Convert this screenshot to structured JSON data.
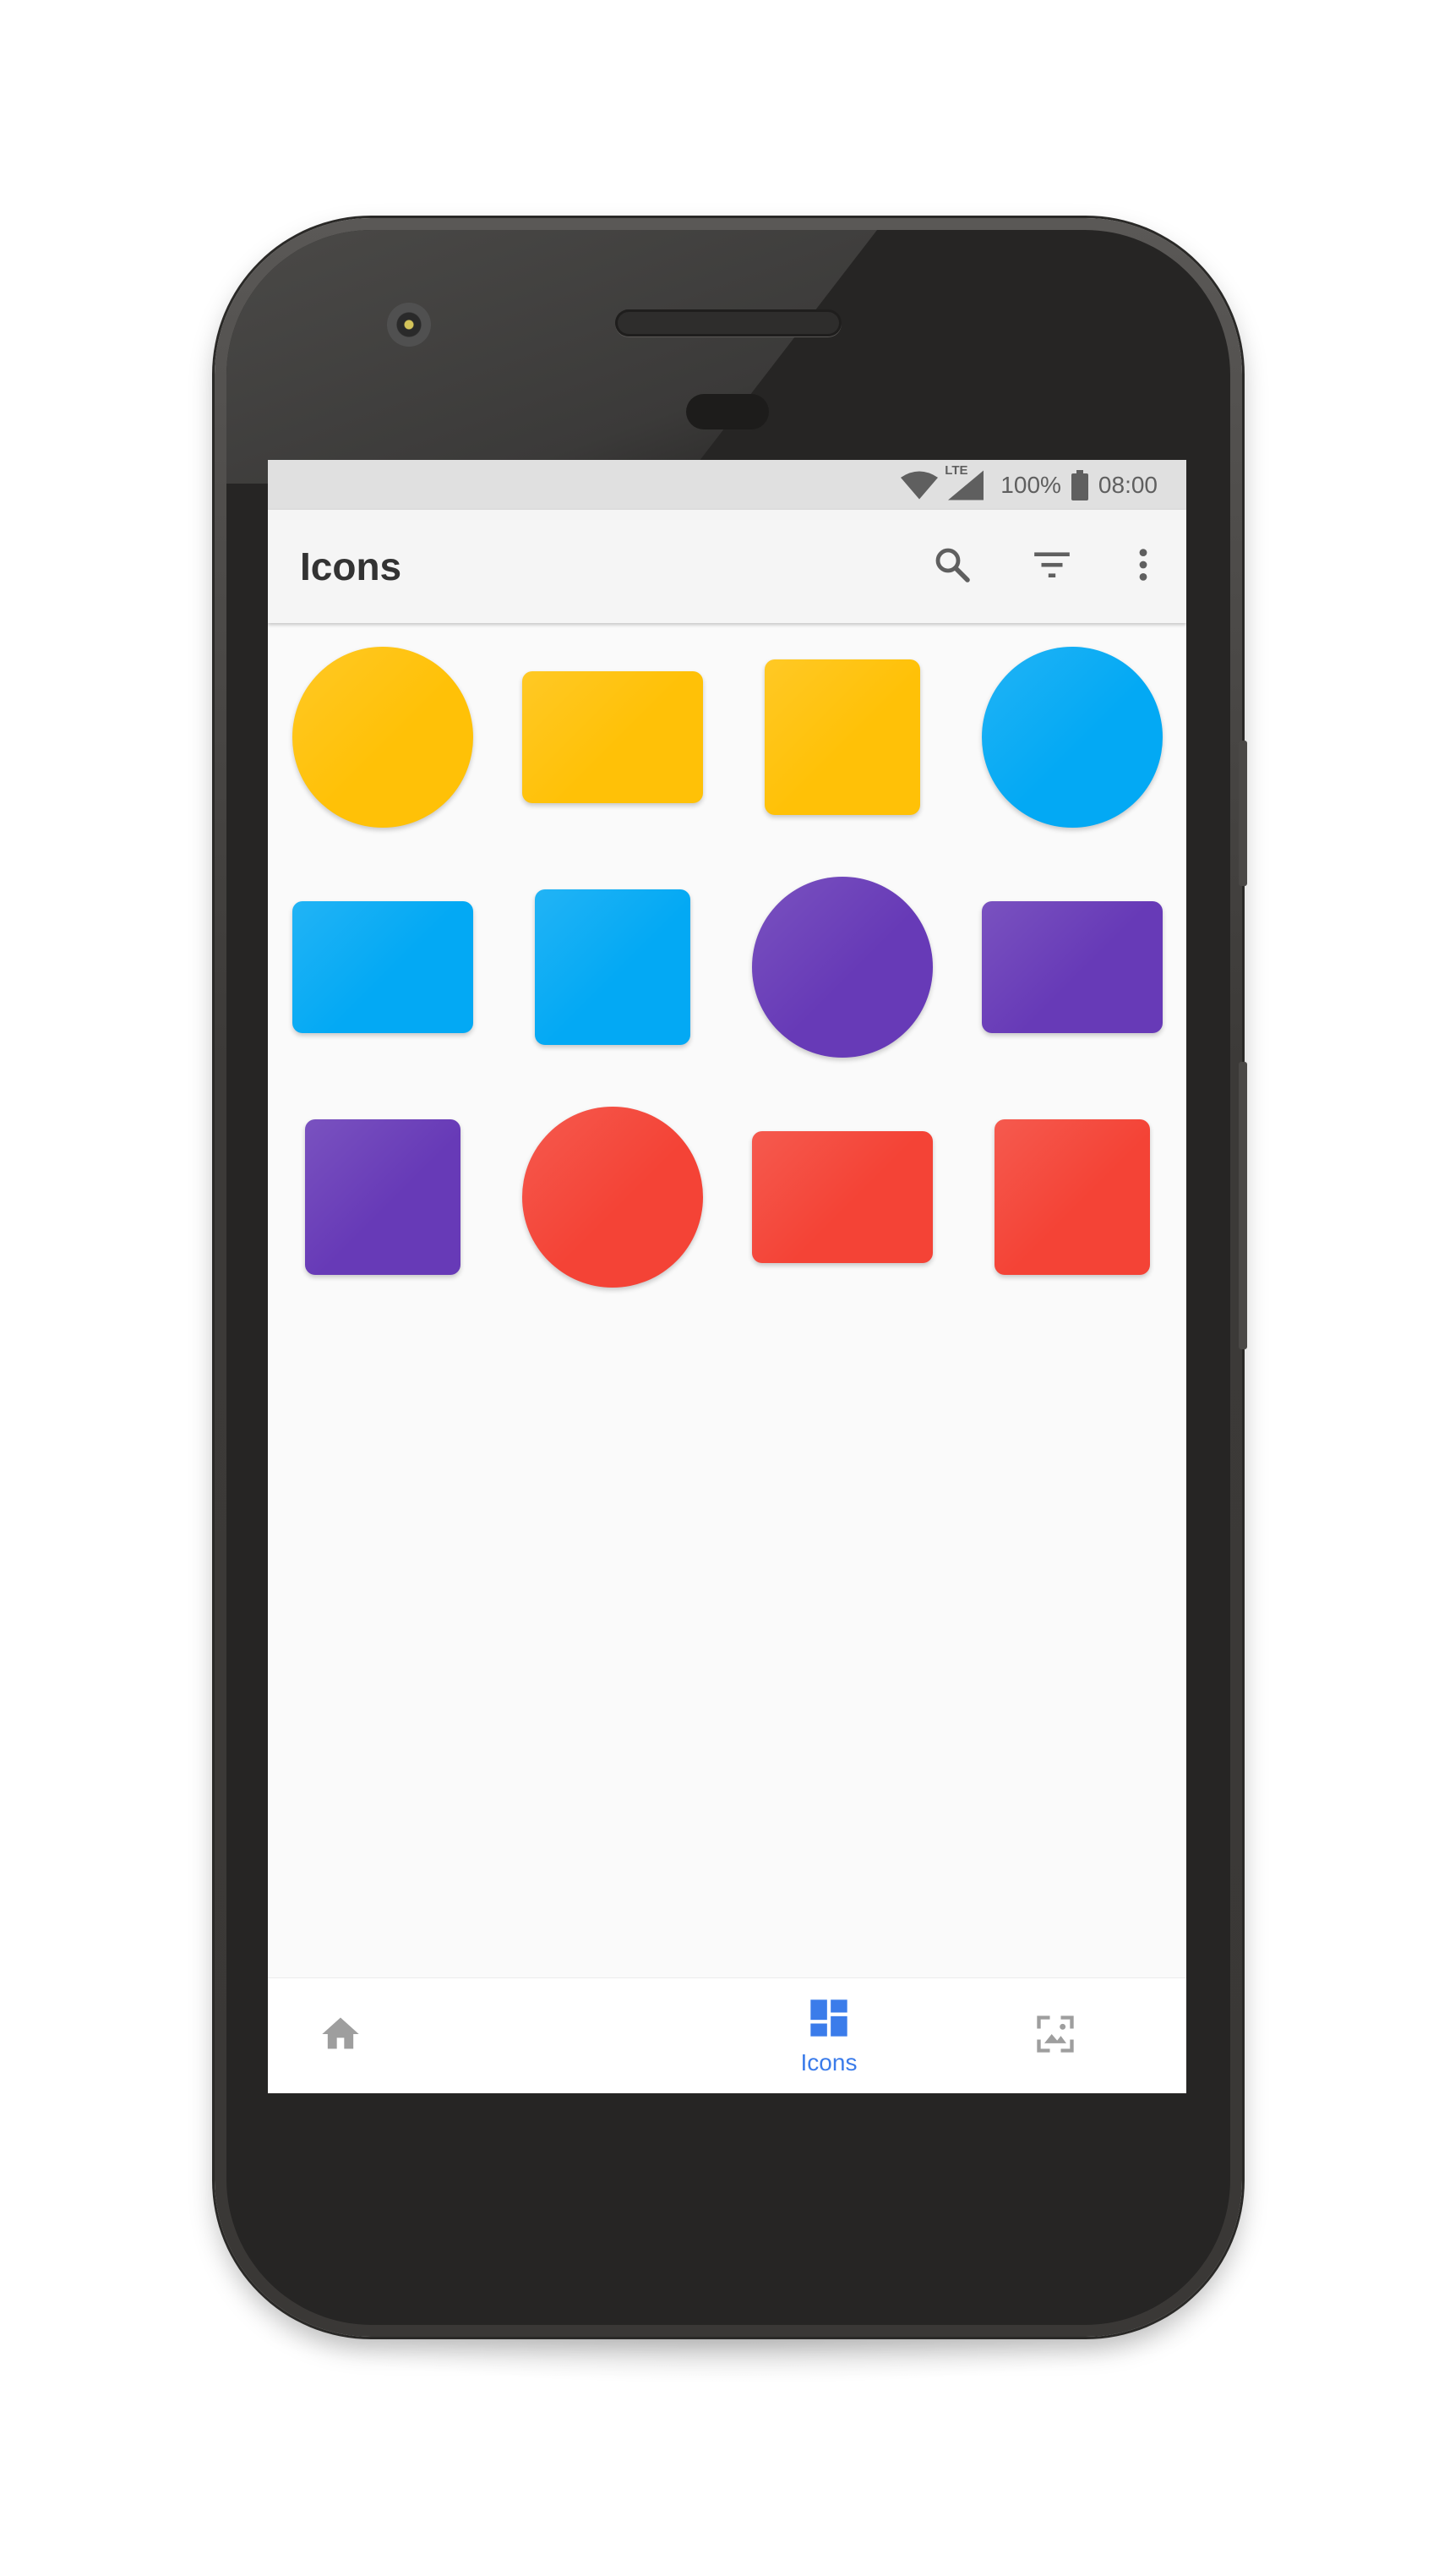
{
  "status_bar": {
    "network": "LTE",
    "battery": "100%",
    "time": "08:00"
  },
  "app_bar": {
    "title": "Icons",
    "actions": [
      "search-icon",
      "filter-icon",
      "more-vert-icon"
    ]
  },
  "colors": {
    "yellow": "#ffc107",
    "blue": "#03a9f4",
    "purple": "#673ab7",
    "red": "#f44336",
    "accent": "#3b7cea",
    "nav_inactive": "#9e9e9e"
  },
  "icon_grid": [
    {
      "shape": "circle",
      "color": "yellow"
    },
    {
      "shape": "rectangle",
      "color": "yellow"
    },
    {
      "shape": "square",
      "color": "yellow"
    },
    {
      "shape": "circle",
      "color": "blue"
    },
    {
      "shape": "rectangle",
      "color": "blue"
    },
    {
      "shape": "square",
      "color": "blue"
    },
    {
      "shape": "circle",
      "color": "purple"
    },
    {
      "shape": "rectangle",
      "color": "purple"
    },
    {
      "shape": "square",
      "color": "purple"
    },
    {
      "shape": "circle",
      "color": "red"
    },
    {
      "shape": "rectangle",
      "color": "red"
    },
    {
      "shape": "square",
      "color": "red"
    }
  ],
  "bottom_nav": {
    "items": [
      {
        "icon": "home-icon",
        "label": "",
        "active": false
      },
      {
        "icon": "dashboard-icon",
        "label": "Icons",
        "active": true
      },
      {
        "icon": "wallpaper-icon",
        "label": "",
        "active": false
      },
      {
        "icon": "apply-icon",
        "label": "",
        "active": false
      },
      {
        "icon": "request-icon",
        "label": "",
        "active": false
      }
    ]
  }
}
